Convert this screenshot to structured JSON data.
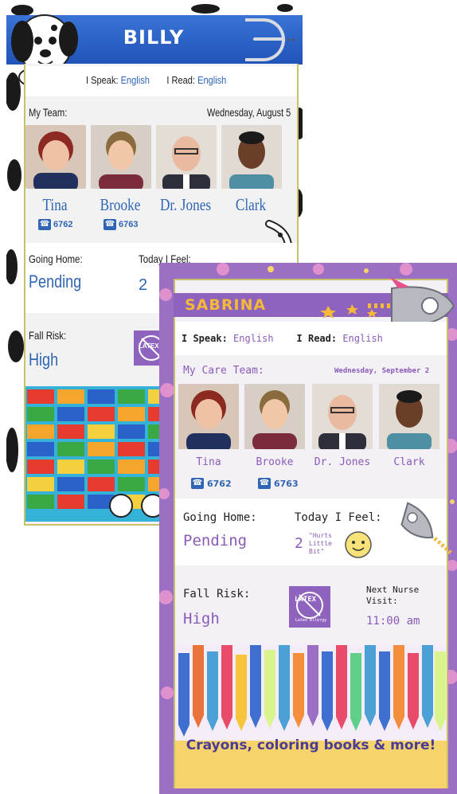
{
  "billy": {
    "name": "BILLY",
    "speak_label": "I Speak:",
    "speak_value": "English",
    "read_label": "I Read:",
    "read_value": "English",
    "team_label": "My Team:",
    "date": "Wednesday, August 5",
    "team": [
      {
        "name": "Tina",
        "ext": "6762"
      },
      {
        "name": "Brooke",
        "ext": "6763"
      },
      {
        "name": "Dr. Jones"
      },
      {
        "name": "Clark"
      }
    ],
    "going_home_label": "Going Home:",
    "going_home_value": "Pending",
    "feel_label": "Today I Feel:",
    "feel_value": "2",
    "fall_risk_label": "Fall Risk:",
    "fall_risk_value": "High",
    "latex_label": "LATEX",
    "colors": {
      "header": "#2a63c9",
      "text_blue": "#2f65b5"
    }
  },
  "sabrina": {
    "name": "SABRINA",
    "speak_label": "I Speak:",
    "speak_value": "English",
    "read_label": "I Read:",
    "read_value": "English",
    "team_label": "My Care Team:",
    "date": "Wednesday, September 2",
    "team": [
      {
        "name": "Tina",
        "ext": "6762"
      },
      {
        "name": "Brooke",
        "ext": "6763"
      },
      {
        "name": "Dr. Jones"
      },
      {
        "name": "Clark"
      }
    ],
    "going_home_label": "Going Home:",
    "going_home_value": "Pending",
    "feel_label": "Today I Feel:",
    "feel_value": "2",
    "feel_note": "\"Hurts Little Bit\"",
    "fall_risk_label": "Fall Risk:",
    "fall_risk_value": "High",
    "latex_label": "LATEX",
    "latex_sub": "Latex Allergy",
    "next_visit_label": "Next Nurse Visit:",
    "next_visit_value": "11:00 am",
    "caption": "Crayons, coloring books & more!",
    "colors": {
      "header": "#8e63bd",
      "name": "#f4b938",
      "text_purple": "#8a5cb8"
    }
  }
}
